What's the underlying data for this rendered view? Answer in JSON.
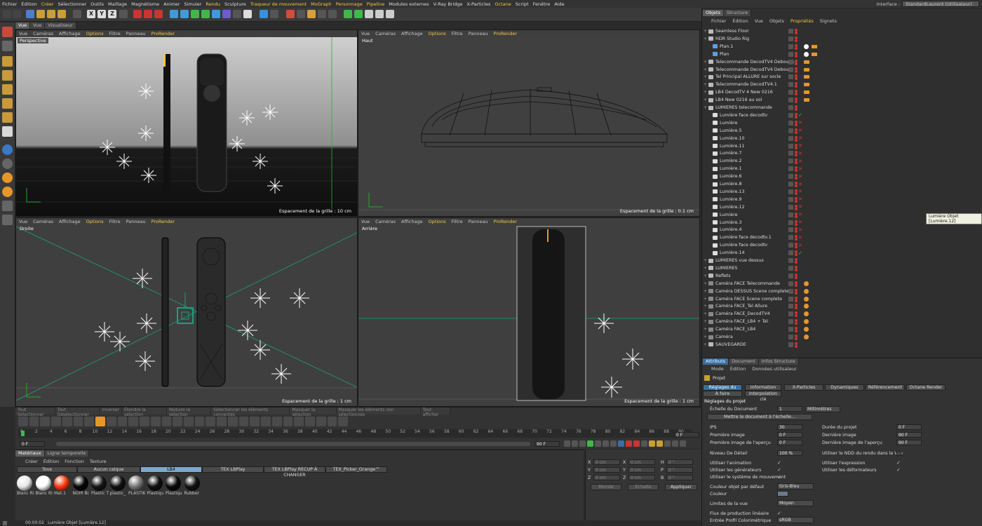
{
  "menu": [
    "Fichier",
    "Édition",
    "Créer",
    "Sélectionner",
    "Outils",
    "Maillage",
    "Magnétisme",
    "Animer",
    "Simuler",
    "Rendu",
    "Sculpture",
    "Traqueur de mouvement",
    "MoGraph",
    "Personnage",
    "Pipeline",
    "Modules externes",
    "V-Ray Bridge",
    "X-Particles",
    "Octane",
    "Script",
    "Fenêtre",
    "Aide"
  ],
  "menu_highlight": [
    "Créer",
    "Rendu",
    "Traqueur de mouvement",
    "MoGraph",
    "Personnage",
    "Pipeline",
    "Octane"
  ],
  "layout": {
    "label": "Interface :",
    "value": "StandardLaurent (Utilisateur)"
  },
  "view_tabs": [
    "Vue",
    "Vue",
    "Visualiseur"
  ],
  "toolbar_axes": [
    "X",
    "Y",
    "Z"
  ],
  "viewport_menu": [
    "Vue",
    "Caméras",
    "Affichage",
    "Options",
    "Filtre",
    "Panneau",
    "ProRender"
  ],
  "viewports": [
    {
      "title": "Perspective",
      "footer": "Espacement de la grille : 10 cm"
    },
    {
      "title": "Haut",
      "footer": "Espacement de la grille : 0.1 cm"
    },
    {
      "title": "Droite",
      "footer": "Espacement de la grille : 1 cm"
    },
    {
      "title": "Arrière",
      "footer": "Espacement de la grille : 1 cm"
    }
  ],
  "timeline_modes": [
    "Tout Sélectionner",
    "Tout Désélectionner",
    "Inverser",
    "Étendre la sélection",
    "Réduire la sélection",
    "Sélectionner les éléments connectés",
    "Masquer la sélection",
    "Masquer les éléments non sélectionnés",
    "Tout afficher"
  ],
  "timeline_ticks": [
    "0",
    "2",
    "4",
    "6",
    "8",
    "10",
    "12",
    "14",
    "16",
    "18",
    "20",
    "22",
    "24",
    "26",
    "28",
    "30",
    "32",
    "34",
    "36",
    "38",
    "40",
    "42",
    "44",
    "46",
    "48",
    "50",
    "52",
    "54",
    "56",
    "58",
    "60",
    "62",
    "64",
    "66",
    "68",
    "70",
    "72",
    "74",
    "76",
    "78",
    "80",
    "82",
    "84",
    "86",
    "88",
    "90"
  ],
  "timeline": {
    "current": "0 F",
    "start": "0 F",
    "end": "90 F",
    "end2": "90 F",
    "frame_field": "0 F"
  },
  "materials": {
    "tabs": [
      "Matériaux",
      "Ligne temporelle"
    ],
    "menu": [
      "Créer",
      "Édition",
      "Fonction",
      "Texture"
    ],
    "filters": [
      "Tous",
      "Aucun calque",
      "LB4",
      "TEX LBPlay",
      "TEX LBPlay RECUP À CHANGER",
      "TEX_Picker_Orange™"
    ],
    "items": [
      {
        "name": "Blanc Ri",
        "color": "#e8e8e8"
      },
      {
        "name": "Blanc Ri",
        "color": "#ffffff"
      },
      {
        "name": "Mat.1",
        "color": "#ff3a10"
      },
      {
        "name": "NOIR BI",
        "color": "#050505"
      },
      {
        "name": "Plastic T",
        "color": "#151515"
      },
      {
        "name": "plastic_",
        "color": "#101010"
      },
      {
        "name": "PLASTIK",
        "color": "#777777"
      },
      {
        "name": "Plastiqu",
        "color": "#101010"
      },
      {
        "name": "Plastiqu",
        "color": "#0a0a0a"
      },
      {
        "name": "Rubber",
        "color": "#121212"
      }
    ]
  },
  "coords": {
    "rows": [
      [
        "X",
        "0 cm",
        "X",
        "0 cm",
        "H",
        "0 °"
      ],
      [
        "Y",
        "0 cm",
        "Y",
        "0 cm",
        "P",
        "0 °"
      ],
      [
        "Z",
        "0 cm",
        "Z",
        "0 cm",
        "B",
        "0 °"
      ]
    ],
    "mode": "Monde",
    "scale": "Échelle",
    "apply": "Appliquer"
  },
  "objects_panel": {
    "tabs": [
      "Objets",
      "Structure"
    ],
    "menu": [
      "Fichier",
      "Édition",
      "Vue",
      "Objets",
      "Propriétés",
      "Signets"
    ],
    "items": [
      {
        "name": "Seamless Floor",
        "indent": 0,
        "type": "L0"
      },
      {
        "name": "HDR Studio Rig",
        "indent": 0,
        "type": "L0"
      },
      {
        "name": "Plan.1",
        "indent": 1,
        "type": "plane"
      },
      {
        "name": "Plan",
        "indent": 1,
        "type": "plane"
      },
      {
        "name": "Telecommande DecodTV4 Debout.1",
        "indent": 0,
        "type": "L0"
      },
      {
        "name": "Telecommande DecodTV4 Debout",
        "indent": 0,
        "type": "L0"
      },
      {
        "name": "Tel Principal ALLURE sur socle",
        "indent": 0,
        "type": "L0"
      },
      {
        "name": "Telecommande DecodTV4.1",
        "indent": 0,
        "type": "L0"
      },
      {
        "name": "LB4 DecodTV 4 New 0216",
        "indent": 0,
        "type": "L0"
      },
      {
        "name": "LB4 New 0216 au sol",
        "indent": 0,
        "type": "L0"
      },
      {
        "name": "LUMIERES telecommande",
        "indent": 0,
        "type": "L0"
      },
      {
        "name": "Lumière face decodtv",
        "indent": 1,
        "type": "light"
      },
      {
        "name": "Lumière",
        "indent": 1,
        "type": "light"
      },
      {
        "name": "Lumière.5",
        "indent": 1,
        "type": "light"
      },
      {
        "name": "Lumière.10",
        "indent": 1,
        "type": "light"
      },
      {
        "name": "Lumière.11",
        "indent": 1,
        "type": "light"
      },
      {
        "name": "Lumière.7",
        "indent": 1,
        "type": "light"
      },
      {
        "name": "Lumière.2",
        "indent": 1,
        "type": "light"
      },
      {
        "name": "Lumière.1",
        "indent": 1,
        "type": "light"
      },
      {
        "name": "Lumière.6",
        "indent": 1,
        "type": "light"
      },
      {
        "name": "Lumière.8",
        "indent": 1,
        "type": "light"
      },
      {
        "name": "Lumière.13",
        "indent": 1,
        "type": "light"
      },
      {
        "name": "Lumière.9",
        "indent": 1,
        "type": "light"
      },
      {
        "name": "Lumière.12",
        "indent": 1,
        "type": "light"
      },
      {
        "name": "Lumière",
        "indent": 1,
        "type": "light"
      },
      {
        "name": "Lumière.3",
        "indent": 1,
        "type": "light"
      },
      {
        "name": "Lumière.4",
        "indent": 1,
        "type": "light"
      },
      {
        "name": "Lumière face decodtv.1",
        "indent": 1,
        "type": "light"
      },
      {
        "name": "Lumière face decodtv",
        "indent": 1,
        "type": "light"
      },
      {
        "name": "Lumière.14",
        "indent": 1,
        "type": "light"
      },
      {
        "name": "LUMIERES vue dessus",
        "indent": 0,
        "type": "L0"
      },
      {
        "name": "LUMIERES",
        "indent": 0,
        "type": "L0"
      },
      {
        "name": "Reflets",
        "indent": 0,
        "type": "L0"
      },
      {
        "name": "Caméra FACE Telecommande",
        "indent": 0,
        "type": "cam"
      },
      {
        "name": "Caméra DESSUS Scene complete",
        "indent": 0,
        "type": "cam"
      },
      {
        "name": "Caméra FACE Scene complete",
        "indent": 0,
        "type": "cam"
      },
      {
        "name": "Caméra FACE_Tel Allure",
        "indent": 0,
        "type": "cam"
      },
      {
        "name": "Caméra FACE_DecodTV4",
        "indent": 0,
        "type": "cam"
      },
      {
        "name": "Caméra FACE_LB4 + Tel",
        "indent": 0,
        "type": "cam"
      },
      {
        "name": "Caméra FACE_LB4",
        "indent": 0,
        "type": "cam"
      },
      {
        "name": "Caméra",
        "indent": 0,
        "type": "cam"
      },
      {
        "name": "SAUVEGARDE",
        "indent": 0,
        "type": "L0"
      }
    ],
    "tooltip": "Lumière Objet [Lumière.12]"
  },
  "attributes": {
    "tabs": [
      "Attributs",
      "Document",
      "Infos Structure"
    ],
    "menu": [
      "Mode",
      "Édition",
      "Données utilisateur"
    ],
    "title": "Projet",
    "subtabs": [
      "Réglages du projet",
      "Information",
      "X-Particles",
      "Dynamiques",
      "Référencement",
      "Octane Render",
      "À faire",
      "Interpolation clé"
    ],
    "section": "Réglages du projet",
    "scale_label": "Échelle du Document",
    "scale_value": "1",
    "scale_unit": "Millimètres",
    "scale_button": "Mettre le document à l'échelle...",
    "fps_label": "IPS",
    "fps": "30",
    "duration_label": "Durée du projet",
    "duration": "0 F",
    "first_label": "Première image",
    "first": "0 F",
    "last_label": "Dernière image",
    "last": "90 F",
    "pfirst_label": "Première image de l'aperçu",
    "pfirst": "0 F",
    "plast_label": "Dernière image de l'aperçu",
    "plast": "90 F",
    "lod_label": "Niveau De Détail",
    "lod": "100 %",
    "lod_render_label": "Utiliser le NDD du rendu dans la Vue",
    "anim_label": "Utiliser l'animation",
    "expr_label": "Utiliser l'expression",
    "gen_label": "Utiliser les générateurs",
    "def_label": "Utiliser les déformateurs",
    "motion_label": "Utiliser le système de mouvement",
    "objcolor_label": "Couleur objet par défaut",
    "objcolor": "Gris-Bleu",
    "color_label": "Couleur",
    "clip_label": "Limites de la vue",
    "clip": "Moyen",
    "linear_label": "Flux de production linéaire",
    "profile_label": "Entrée Profil Colorimétrique",
    "profile": "sRGB"
  },
  "status": {
    "time": "00:00:02",
    "text": "Lumière Objet [Lumière.12]"
  }
}
